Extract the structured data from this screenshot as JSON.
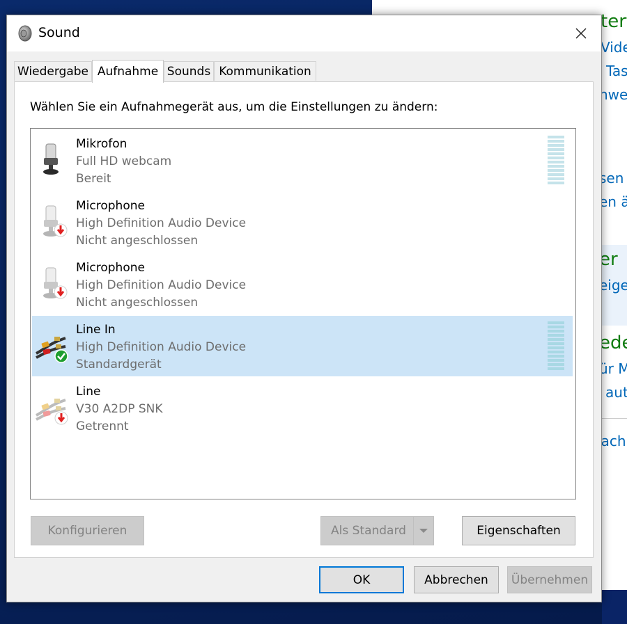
{
  "dialog": {
    "title": "Sound",
    "icon": "speaker-icon"
  },
  "tabs": [
    {
      "label": "Wiedergabe",
      "active": false
    },
    {
      "label": "Aufnahme",
      "active": true
    },
    {
      "label": "Sounds",
      "active": false
    },
    {
      "label": "Kommunikation",
      "active": false
    }
  ],
  "instruction": "Wählen Sie ein Aufnahmegerät aus, um die Einstellungen zu ändern:",
  "devices": [
    {
      "name": "Mikrofon",
      "description": "Full HD webcam",
      "status": "Bereit",
      "icon": "microphone-icon",
      "badge": "none",
      "selected": false,
      "level_meter": true
    },
    {
      "name": "Microphone",
      "description": "High Definition Audio Device",
      "status": "Nicht angeschlossen",
      "icon": "microphone-icon",
      "badge": "unplugged-arrow",
      "selected": false,
      "level_meter": false
    },
    {
      "name": "Microphone",
      "description": "High Definition Audio Device",
      "status": "Nicht angeschlossen",
      "icon": "microphone-icon",
      "badge": "unplugged-arrow",
      "selected": false,
      "level_meter": false
    },
    {
      "name": "Line In",
      "description": "High Definition Audio Device",
      "status": "Standardgerät",
      "icon": "line-in-cable-icon",
      "badge": "default-check",
      "selected": true,
      "level_meter": true
    },
    {
      "name": "Line",
      "description": "V30 A2DP SNK",
      "status": "Getrennt",
      "icon": "line-in-cable-icon",
      "badge": "unplugged-arrow",
      "selected": false,
      "level_meter": false
    }
  ],
  "buttons": {
    "configure": "Konfigurieren",
    "set_default": "Als Standard",
    "properties": "Eigenschaften",
    "ok": "OK",
    "cancel": "Abbrechen",
    "apply": "Übernehmen"
  },
  "background_window": {
    "lines": [
      "tert",
      "Vide",
      "Tas",
      "nwei",
      "sen",
      "en ä",
      "er",
      "eige",
      "ede",
      "ür M",
      "n aut",
      "nach"
    ]
  },
  "colors": {
    "selection": "#cce4f7",
    "accent": "#0078d7",
    "meter": "#a8d8e4",
    "default_badge": "#1e9e2e",
    "unplugged_badge": "#e02020"
  }
}
